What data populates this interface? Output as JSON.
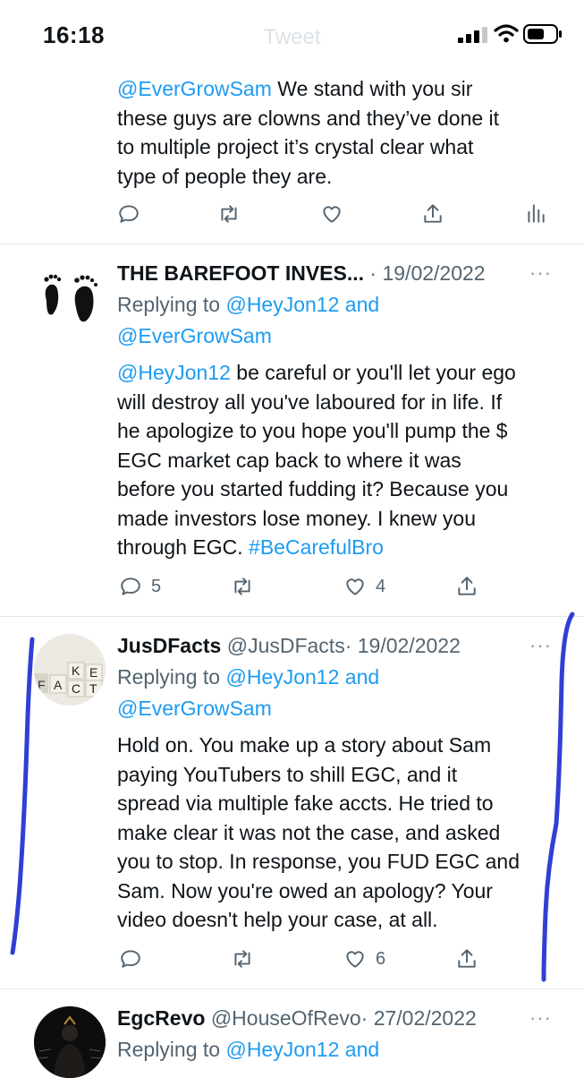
{
  "status_bar": {
    "time": "16:18",
    "ghost_title": "Tweet"
  },
  "tweets": [
    {
      "body_lines": [
        {
          "mention": "@EverGrowSam",
          "text": " We stand with you sir"
        },
        {
          "text": "these guys are clowns and they’ve done it"
        },
        {
          "text": "to multiple project it’s crystal clear what"
        },
        {
          "text": "type of people they are."
        }
      ],
      "reply_count": "",
      "retweet_count": "",
      "like_count": ""
    },
    {
      "display_name": "THE BAREFOOT INVES...",
      "handle": "",
      "date": "· 19/02/2022",
      "replying_label": "Replying to",
      "replying_to_1": "@HeyJon12 and",
      "replying_to_2": "@EverGrowSam",
      "body_lines": [
        {
          "mention": "@HeyJon12",
          "text": " be careful or you'll let your ego"
        },
        {
          "text": "will destroy all you've laboured for in life. If"
        },
        {
          "text": "he apologize to you hope you'll pump the $"
        },
        {
          "text": "EGC market cap back to where it was"
        },
        {
          "text": "before you started fudding it? Because you"
        },
        {
          "text": "made investors lose money. I knew  you"
        },
        {
          "text": "through EGC. ",
          "hashtag": "#BeCarefulBro"
        }
      ],
      "reply_count": "5",
      "retweet_count": "",
      "like_count": "4"
    },
    {
      "display_name": "JusDFacts",
      "handle": "@JusDFacts",
      "date": "· 19/02/2022",
      "replying_label": "Replying to",
      "replying_to_1": "@HeyJon12 and",
      "replying_to_2": "@EverGrowSam",
      "body_lines": [
        {
          "text": "Hold on. You make up a story about Sam"
        },
        {
          "text": "paying YouTubers to shill EGC, and it"
        },
        {
          "text": "spread via multiple fake accts. He tried to"
        },
        {
          "text": "make clear it was not the case, and asked"
        },
        {
          "text": "you to stop. In response, you FUD EGC and"
        },
        {
          "text": "Sam. Now you're owed an apology? Your"
        },
        {
          "text": "video doesn't help your case, at all."
        }
      ],
      "reply_count": "",
      "retweet_count": "",
      "like_count": "6",
      "avatar_letters": [
        "F",
        "A",
        "K",
        "C",
        "E",
        "T"
      ]
    },
    {
      "display_name": "EgcRevo",
      "handle": "@HouseOfRevo",
      "date": "· 27/02/2022",
      "replying_label": "Replying to",
      "replying_to_1": "@HeyJon12 and"
    }
  ],
  "more_glyph": "···",
  "colors": {
    "link": "#1d9bf0",
    "muted": "#536471",
    "scribble": "#2f3fd6"
  },
  "icons": [
    "reply-icon",
    "retweet-icon",
    "like-icon",
    "share-icon",
    "analytics-icon",
    "more-icon"
  ]
}
